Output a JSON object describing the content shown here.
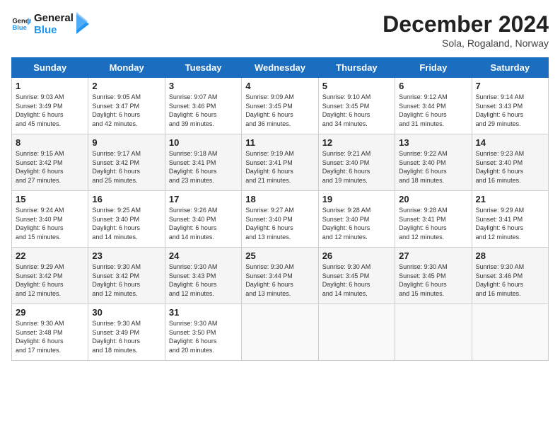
{
  "header": {
    "logo_line1": "General",
    "logo_line2": "Blue",
    "month": "December 2024",
    "location": "Sola, Rogaland, Norway"
  },
  "days_of_week": [
    "Sunday",
    "Monday",
    "Tuesday",
    "Wednesday",
    "Thursday",
    "Friday",
    "Saturday"
  ],
  "weeks": [
    [
      {
        "day": 1,
        "lines": [
          "Sunrise: 9:03 AM",
          "Sunset: 3:49 PM",
          "Daylight: 6 hours",
          "and 45 minutes."
        ]
      },
      {
        "day": 2,
        "lines": [
          "Sunrise: 9:05 AM",
          "Sunset: 3:47 PM",
          "Daylight: 6 hours",
          "and 42 minutes."
        ]
      },
      {
        "day": 3,
        "lines": [
          "Sunrise: 9:07 AM",
          "Sunset: 3:46 PM",
          "Daylight: 6 hours",
          "and 39 minutes."
        ]
      },
      {
        "day": 4,
        "lines": [
          "Sunrise: 9:09 AM",
          "Sunset: 3:45 PM",
          "Daylight: 6 hours",
          "and 36 minutes."
        ]
      },
      {
        "day": 5,
        "lines": [
          "Sunrise: 9:10 AM",
          "Sunset: 3:45 PM",
          "Daylight: 6 hours",
          "and 34 minutes."
        ]
      },
      {
        "day": 6,
        "lines": [
          "Sunrise: 9:12 AM",
          "Sunset: 3:44 PM",
          "Daylight: 6 hours",
          "and 31 minutes."
        ]
      },
      {
        "day": 7,
        "lines": [
          "Sunrise: 9:14 AM",
          "Sunset: 3:43 PM",
          "Daylight: 6 hours",
          "and 29 minutes."
        ]
      }
    ],
    [
      {
        "day": 8,
        "lines": [
          "Sunrise: 9:15 AM",
          "Sunset: 3:42 PM",
          "Daylight: 6 hours",
          "and 27 minutes."
        ]
      },
      {
        "day": 9,
        "lines": [
          "Sunrise: 9:17 AM",
          "Sunset: 3:42 PM",
          "Daylight: 6 hours",
          "and 25 minutes."
        ]
      },
      {
        "day": 10,
        "lines": [
          "Sunrise: 9:18 AM",
          "Sunset: 3:41 PM",
          "Daylight: 6 hours",
          "and 23 minutes."
        ]
      },
      {
        "day": 11,
        "lines": [
          "Sunrise: 9:19 AM",
          "Sunset: 3:41 PM",
          "Daylight: 6 hours",
          "and 21 minutes."
        ]
      },
      {
        "day": 12,
        "lines": [
          "Sunrise: 9:21 AM",
          "Sunset: 3:40 PM",
          "Daylight: 6 hours",
          "and 19 minutes."
        ]
      },
      {
        "day": 13,
        "lines": [
          "Sunrise: 9:22 AM",
          "Sunset: 3:40 PM",
          "Daylight: 6 hours",
          "and 18 minutes."
        ]
      },
      {
        "day": 14,
        "lines": [
          "Sunrise: 9:23 AM",
          "Sunset: 3:40 PM",
          "Daylight: 6 hours",
          "and 16 minutes."
        ]
      }
    ],
    [
      {
        "day": 15,
        "lines": [
          "Sunrise: 9:24 AM",
          "Sunset: 3:40 PM",
          "Daylight: 6 hours",
          "and 15 minutes."
        ]
      },
      {
        "day": 16,
        "lines": [
          "Sunrise: 9:25 AM",
          "Sunset: 3:40 PM",
          "Daylight: 6 hours",
          "and 14 minutes."
        ]
      },
      {
        "day": 17,
        "lines": [
          "Sunrise: 9:26 AM",
          "Sunset: 3:40 PM",
          "Daylight: 6 hours",
          "and 14 minutes."
        ]
      },
      {
        "day": 18,
        "lines": [
          "Sunrise: 9:27 AM",
          "Sunset: 3:40 PM",
          "Daylight: 6 hours",
          "and 13 minutes."
        ]
      },
      {
        "day": 19,
        "lines": [
          "Sunrise: 9:28 AM",
          "Sunset: 3:40 PM",
          "Daylight: 6 hours",
          "and 12 minutes."
        ]
      },
      {
        "day": 20,
        "lines": [
          "Sunrise: 9:28 AM",
          "Sunset: 3:41 PM",
          "Daylight: 6 hours",
          "and 12 minutes."
        ]
      },
      {
        "day": 21,
        "lines": [
          "Sunrise: 9:29 AM",
          "Sunset: 3:41 PM",
          "Daylight: 6 hours",
          "and 12 minutes."
        ]
      }
    ],
    [
      {
        "day": 22,
        "lines": [
          "Sunrise: 9:29 AM",
          "Sunset: 3:42 PM",
          "Daylight: 6 hours",
          "and 12 minutes."
        ]
      },
      {
        "day": 23,
        "lines": [
          "Sunrise: 9:30 AM",
          "Sunset: 3:42 PM",
          "Daylight: 6 hours",
          "and 12 minutes."
        ]
      },
      {
        "day": 24,
        "lines": [
          "Sunrise: 9:30 AM",
          "Sunset: 3:43 PM",
          "Daylight: 6 hours",
          "and 12 minutes."
        ]
      },
      {
        "day": 25,
        "lines": [
          "Sunrise: 9:30 AM",
          "Sunset: 3:44 PM",
          "Daylight: 6 hours",
          "and 13 minutes."
        ]
      },
      {
        "day": 26,
        "lines": [
          "Sunrise: 9:30 AM",
          "Sunset: 3:45 PM",
          "Daylight: 6 hours",
          "and 14 minutes."
        ]
      },
      {
        "day": 27,
        "lines": [
          "Sunrise: 9:30 AM",
          "Sunset: 3:45 PM",
          "Daylight: 6 hours",
          "and 15 minutes."
        ]
      },
      {
        "day": 28,
        "lines": [
          "Sunrise: 9:30 AM",
          "Sunset: 3:46 PM",
          "Daylight: 6 hours",
          "and 16 minutes."
        ]
      }
    ],
    [
      {
        "day": 29,
        "lines": [
          "Sunrise: 9:30 AM",
          "Sunset: 3:48 PM",
          "Daylight: 6 hours",
          "and 17 minutes."
        ]
      },
      {
        "day": 30,
        "lines": [
          "Sunrise: 9:30 AM",
          "Sunset: 3:49 PM",
          "Daylight: 6 hours",
          "and 18 minutes."
        ]
      },
      {
        "day": 31,
        "lines": [
          "Sunrise: 9:30 AM",
          "Sunset: 3:50 PM",
          "Daylight: 6 hours",
          "and 20 minutes."
        ]
      },
      null,
      null,
      null,
      null
    ]
  ]
}
